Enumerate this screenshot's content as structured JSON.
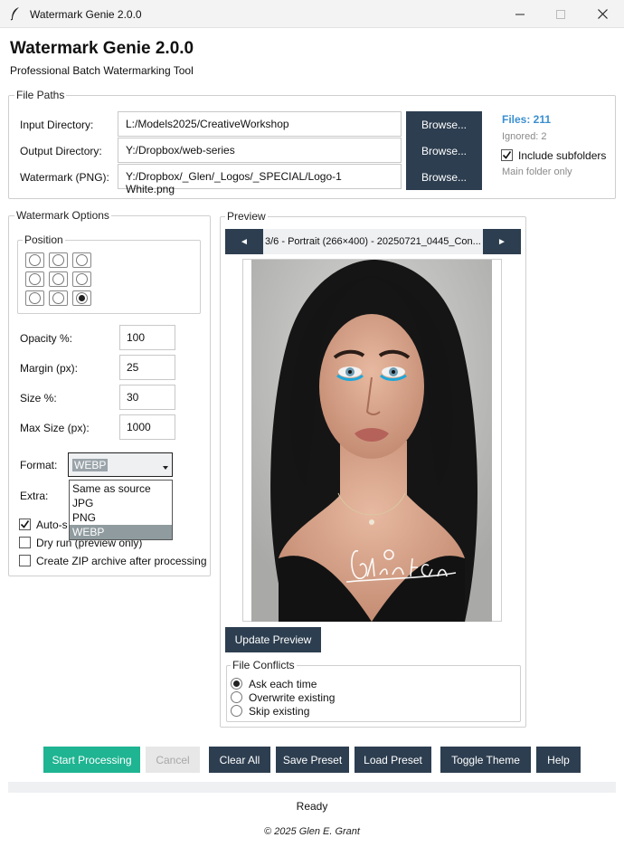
{
  "window": {
    "title": "Watermark Genie 2.0.0",
    "controls": [
      "minimize-icon",
      "maximize-icon",
      "close-icon"
    ]
  },
  "header": {
    "title": "Watermark Genie 2.0.0",
    "subtitle": "Professional Batch Watermarking Tool"
  },
  "file_paths": {
    "legend": "File Paths",
    "rows": [
      {
        "label": "Input Directory:",
        "value": "L:/Models2025/CreativeWorkshop",
        "button": "Browse..."
      },
      {
        "label": "Output Directory:",
        "value": "Y:/Dropbox/web-series",
        "button": "Browse..."
      },
      {
        "label": "Watermark (PNG):",
        "value": "Y:/Dropbox/_Glen/_Logos/_SPECIAL/Logo-1 White.png",
        "button": "Browse..."
      }
    ],
    "files_count": "Files: 211",
    "ignored": "Ignored: 2",
    "include_subfolders": {
      "label": "Include subfolders",
      "checked": true
    },
    "main_folder_only": "Main folder only"
  },
  "options": {
    "legend": "Watermark Options",
    "position_legend": "Position",
    "position_selected": "bottom-right",
    "fields": [
      {
        "label": "Opacity %:",
        "value": "100"
      },
      {
        "label": "Margin (px):",
        "value": "25"
      },
      {
        "label": "Size %:",
        "value": "30"
      },
      {
        "label": "Max Size (px):",
        "value": "1000"
      }
    ],
    "format_label": "Format:",
    "format_value": "WEBP",
    "format_options": [
      "Same as source",
      "JPG",
      "PNG",
      "WEBP"
    ],
    "extra_label": "Extra:",
    "auto_label": "Auto-s",
    "auto_checked": true,
    "dry_run_label": "Dry run (preview only)",
    "dry_run_checked": false,
    "zip_label": "Create ZIP archive after processing",
    "zip_checked": false
  },
  "preview": {
    "legend": "Preview",
    "prev": "◄",
    "next": "►",
    "title": "3/6 - Portrait (266×400) - 20250721_0445_Con...",
    "watermark_text": "Glen E. Grant",
    "update_button": "Update Preview",
    "conflicts_legend": "File Conflicts",
    "conflicts": [
      {
        "label": "Ask each time",
        "selected": true
      },
      {
        "label": "Overwrite existing",
        "selected": false
      },
      {
        "label": "Skip existing",
        "selected": false
      }
    ]
  },
  "actions": {
    "start": "Start Processing",
    "cancel": "Cancel",
    "clear": "Clear All",
    "save": "Save Preset",
    "load": "Load Preset",
    "theme": "Toggle Theme",
    "help": "Help"
  },
  "status": "Ready",
  "footer": "© 2025 Glen E. Grant",
  "colors": {
    "dark_button": "#2d3e50",
    "start_button": "#1fb492",
    "files_count": "#3a8fd0",
    "selected_option": "#8f9b9f"
  }
}
